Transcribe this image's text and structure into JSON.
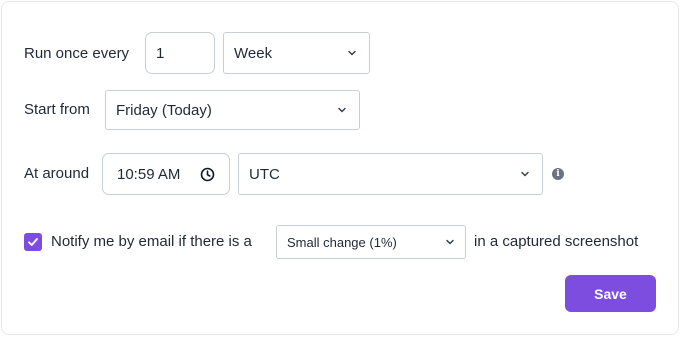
{
  "schedule": {
    "run_label": "Run once every",
    "interval_value": "1",
    "interval_unit": "Week",
    "start_label": "Start from",
    "start_value": "Friday (Today)",
    "around_label": "At around",
    "time_value": "10:59 AM",
    "timezone_value": "UTC"
  },
  "notify": {
    "checked": true,
    "prefix": "Notify me by email if there is a",
    "threshold_value": "Small change (1%)",
    "suffix": "in a captured screenshot"
  },
  "actions": {
    "save_label": "Save"
  },
  "colors": {
    "accent": "#7c4ddf",
    "border": "#c9ced6"
  },
  "icons": {
    "clock": "clock-icon",
    "chevron": "chevron-down-icon",
    "info": "info-icon",
    "check": "checkmark-icon"
  }
}
